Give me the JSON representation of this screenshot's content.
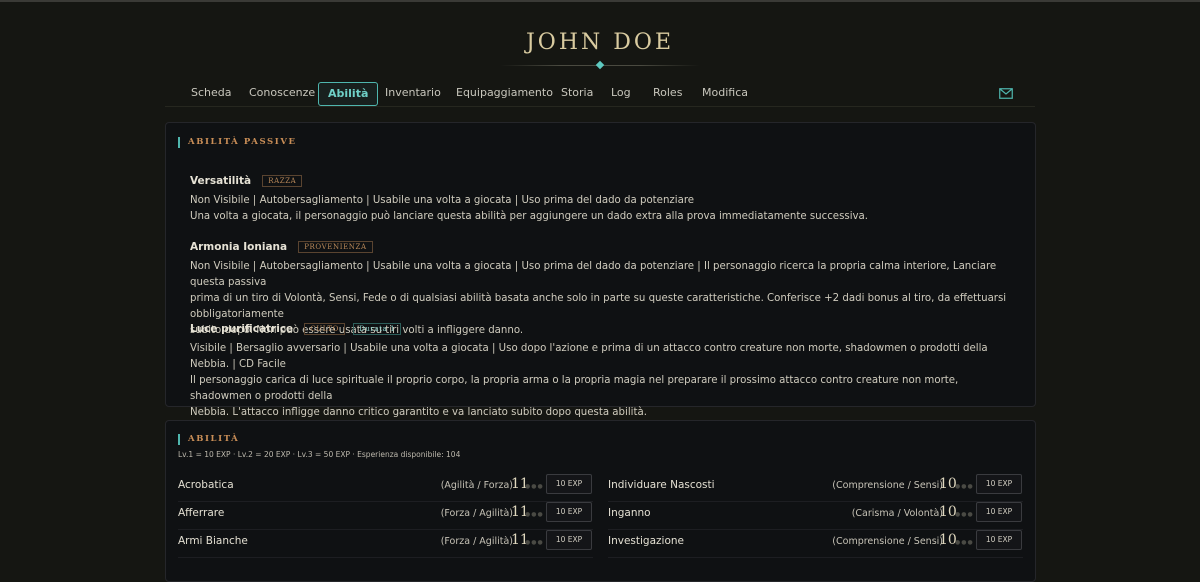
{
  "header": {
    "title": "JOHN DOE"
  },
  "nav": {
    "tabs": [
      {
        "label": "Scheda"
      },
      {
        "label": "Conoscenze"
      },
      {
        "label": "Abilità"
      },
      {
        "label": "Inventario"
      },
      {
        "label": "Equipaggiamento"
      },
      {
        "label": "Storia"
      },
      {
        "label": "Log"
      },
      {
        "label": "Roles"
      },
      {
        "label": "Modifica"
      }
    ],
    "active_tab": "Abilità",
    "mail_icon": "mail-icon"
  },
  "passive": {
    "title": "ABILITÀ PASSIVE",
    "items": [
      {
        "name": "Versatilità",
        "badges": [
          "RAZZA"
        ],
        "lines": [
          "Non Visibile | Autobersagliamento | Usabile una volta a giocata | Uso prima del dado da potenziare",
          "Una volta a giocata, il personaggio può lanciare questa abilità per aggiungere un dado extra alla prova immediatamente successiva."
        ]
      },
      {
        "name": "Armonia Ioniana",
        "badges": [
          "PROVENIENZA"
        ],
        "lines": [
          "Non Visibile | Autobersagliamento | Usabile una volta a giocata | Uso prima del dado da potenziare | Il personaggio ricerca la propria calma interiore, Lanciare questa passiva",
          "prima di un tiro di Volontà, Sensi, Fede o di qualsiasi abilità basata anche solo in parte su queste caratteristiche. Conferisce +2 dadi bonus al tiro, da effettuarsi obbligatoriamente",
          "subito dopo. Non può essere usata su tiri volti a infliggere danno."
        ]
      },
      {
        "name": "Luce purificatrice",
        "badges": [
          "CULTO",
          "Durata 1"
        ],
        "lines": [
          "Visibile | Bersaglio avversario | Usabile una volta a giocata | Uso dopo l'azione e prima di un attacco contro creature non morte, shadowmen o prodotti della Nebbia. | CD Facile",
          "Il personaggio carica di luce spirituale il proprio corpo, la propria arma o la propria magia nel preparare il prossimo attacco contro creature non morte, shadowmen o prodotti della",
          "Nebbia. L'attacco infligge danno critico garantito e va lanciato subito dopo questa abilità."
        ]
      }
    ]
  },
  "skills": {
    "title": "ABILITÀ",
    "xp_info": "Lv.1 = 10 EXP · Lv.2 = 20 EXP · Lv.3 = 50 EXP · Esperienza disponibile: 104",
    "left": [
      {
        "name": "Acrobatica",
        "stats": "(Agilità / Forza)",
        "value": "11",
        "button": "10 EXP"
      },
      {
        "name": "Afferrare",
        "stats": "(Forza / Agilità)",
        "value": "11",
        "button": "10 EXP"
      },
      {
        "name": "Armi Bianche",
        "stats": "(Forza / Agilità)",
        "value": "11",
        "button": "10 EXP"
      }
    ],
    "right": [
      {
        "name": "Individuare Nascosti",
        "stats": "(Comprensione / Sensi)",
        "value": "10",
        "button": "10 EXP"
      },
      {
        "name": "Inganno",
        "stats": "(Carisma / Volontà)",
        "value": "10",
        "button": "10 EXP"
      },
      {
        "name": "Investigazione",
        "stats": "(Comprensione / Sensi)",
        "value": "10",
        "button": "10 EXP"
      }
    ]
  },
  "colors": {
    "accent": "#4fb6ae",
    "gold": "#d9cba0",
    "orange": "#c98e57",
    "background": "#151612"
  }
}
